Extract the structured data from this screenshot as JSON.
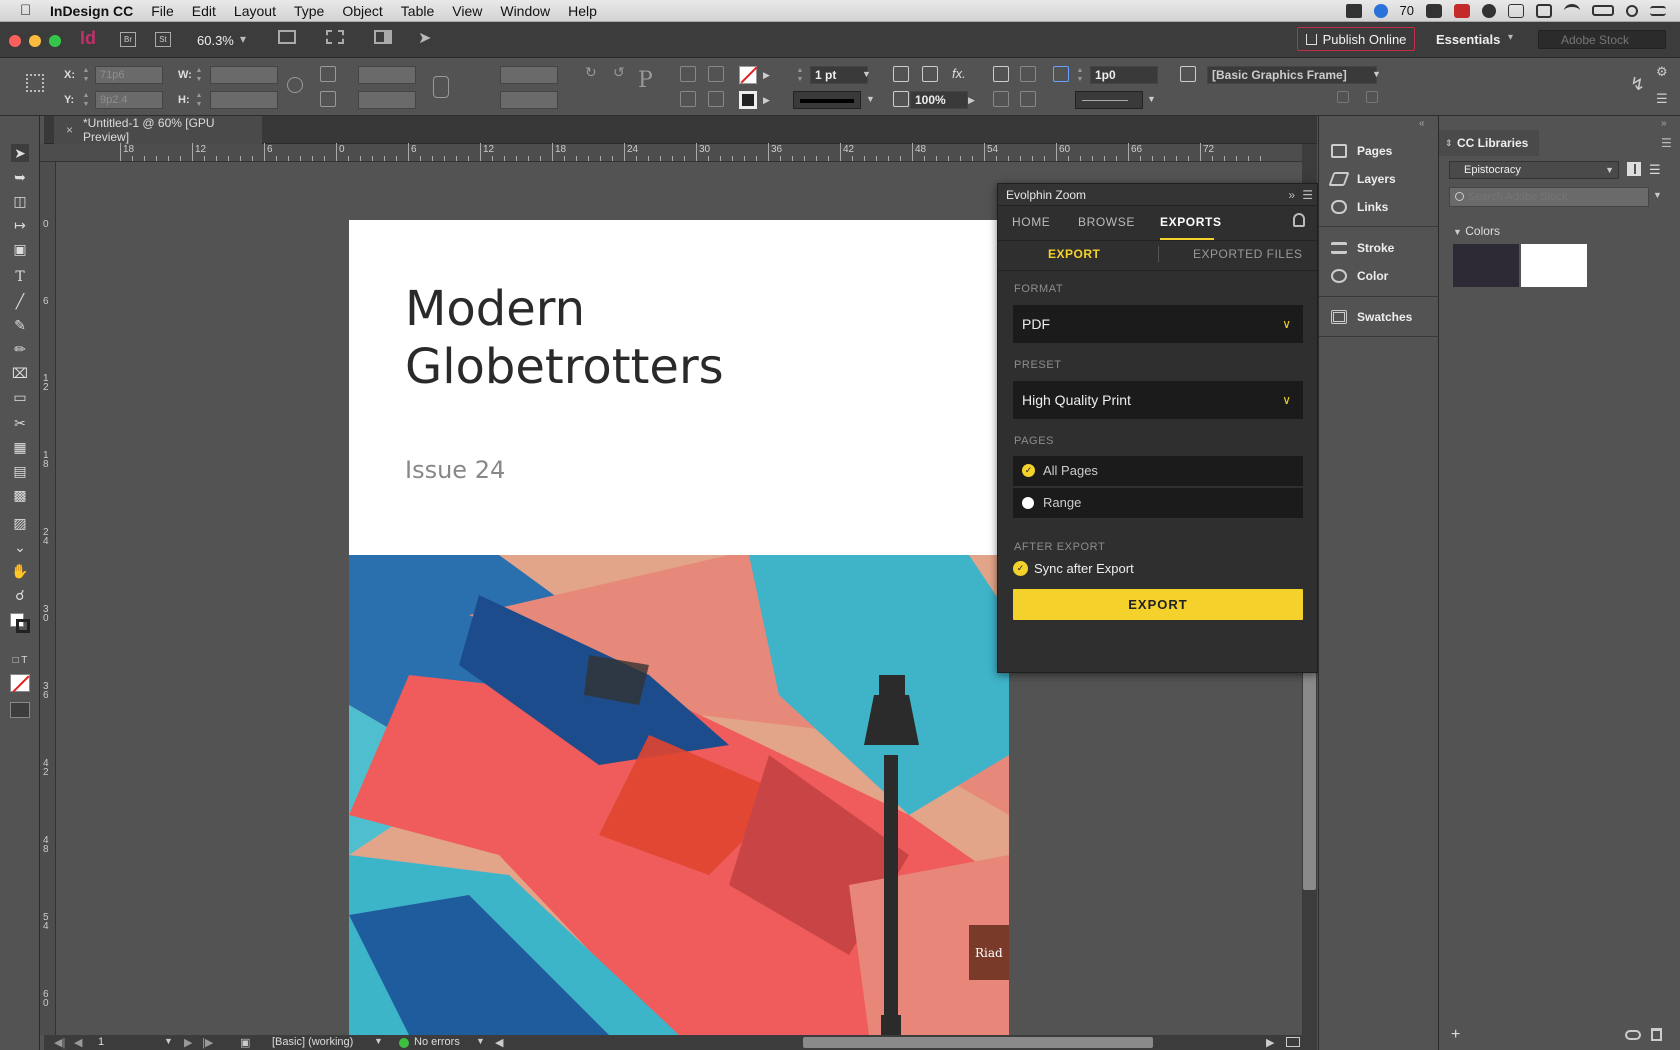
{
  "menubar": {
    "app_name": "InDesign CC",
    "items": [
      "File",
      "Edit",
      "Layout",
      "Type",
      "Object",
      "Table",
      "View",
      "Window",
      "Help"
    ],
    "tray_badge": "70"
  },
  "appbar": {
    "br_label": "Br",
    "st_label": "St",
    "zoom": "60.3%",
    "publish_label": "Publish Online",
    "workspace": "Essentials",
    "stock_placeholder": "Adobe Stock"
  },
  "control": {
    "x_label": "X:",
    "x_value": "71p6",
    "y_label": "Y:",
    "y_value": "9p2.4",
    "w_label": "W:",
    "h_label": "H:",
    "stroke_weight": "1 pt",
    "opacity": "100%",
    "frame_value": "1p0",
    "object_style": "[Basic Graphics Frame]"
  },
  "document": {
    "tab_title": "*Untitled-1 @ 60% [GPU Preview]",
    "title_line1": "Modern",
    "title_line2": "Globetrotters",
    "issue": "Issue 24"
  },
  "rulers": {
    "h_labels": [
      "18",
      "12",
      "6",
      "0",
      "6",
      "12",
      "18",
      "24",
      "30",
      "36",
      "42",
      "48",
      "54",
      "60",
      "66",
      "72"
    ],
    "v_labels": [
      "0",
      "6",
      "12",
      "18",
      "24",
      "30",
      "36",
      "42",
      "48",
      "54",
      "60"
    ]
  },
  "status": {
    "page": "1",
    "preflight_profile": "[Basic] (working)",
    "errors": "No errors"
  },
  "evolphin": {
    "title": "Evolphin Zoom",
    "tabs": [
      "HOME",
      "BROWSE",
      "EXPORTS"
    ],
    "subtabs": [
      "EXPORT",
      "EXPORTED FILES"
    ],
    "format_label": "FORMAT",
    "format_value": "PDF",
    "preset_label": "PRESET",
    "preset_value": "High Quality Print",
    "pages_label": "PAGES",
    "page_all": "All Pages",
    "page_range": "Range",
    "after_label": "AFTER EXPORT",
    "sync_label": "Sync after Export",
    "export_button": "EXPORT",
    "accent": "#f5d22b"
  },
  "dock": {
    "items": [
      "Pages",
      "Layers",
      "Links",
      "Stroke",
      "Color",
      "Swatches"
    ]
  },
  "cc_libraries": {
    "title": "CC Libraries",
    "library": "Epistocracy",
    "search_placeholder": "Search Adobe Stock",
    "colors_label": "Colors",
    "swatches": [
      "#2d2a36",
      "#ffffff"
    ]
  }
}
